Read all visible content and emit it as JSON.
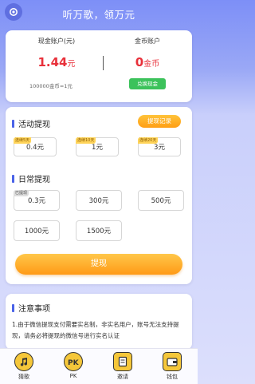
{
  "header": {
    "title": "听万歌，领万元",
    "settings_icon": "gear-icon"
  },
  "account": {
    "cash_label": "现金账户(元)",
    "cash_value": "1.44",
    "cash_unit": "元",
    "gold_label": "金币账户",
    "gold_value": "0",
    "gold_unit": "金币",
    "rate_text": "100000金币=1元",
    "exchange_button": "兑换现金"
  },
  "activity": {
    "title": "活动提现",
    "record_button": "提现记录",
    "options": [
      {
        "tag": "连续5天",
        "value": "0.4元"
      },
      {
        "tag": "连续10天",
        "value": "1元"
      },
      {
        "tag": "连续20天",
        "value": "3元"
      }
    ]
  },
  "daily": {
    "title": "日常提现",
    "options": [
      {
        "tag": "已提现",
        "value": "0.3元"
      },
      {
        "value": "300元"
      },
      {
        "value": "500元"
      },
      {
        "value": "1000元"
      },
      {
        "value": "1500元"
      }
    ]
  },
  "submit_button": "提现",
  "notice": {
    "title": "注意事项",
    "text": "1.由于微信提现支付需要实名制，非实名用户，账号无法支持提现，请务必将提现的微信号进行实名认证"
  },
  "tabbar": [
    {
      "label": "猜歌",
      "icon": "music-note-icon"
    },
    {
      "label": "PK",
      "icon": "pk-icon"
    },
    {
      "label": "邀请",
      "icon": "invite-icon"
    },
    {
      "label": "钱包",
      "icon": "wallet-icon"
    }
  ],
  "colors": {
    "accent": "#4a63e8",
    "red": "#e8303a",
    "green": "#3cc25b",
    "orange": "#ff9e14"
  }
}
